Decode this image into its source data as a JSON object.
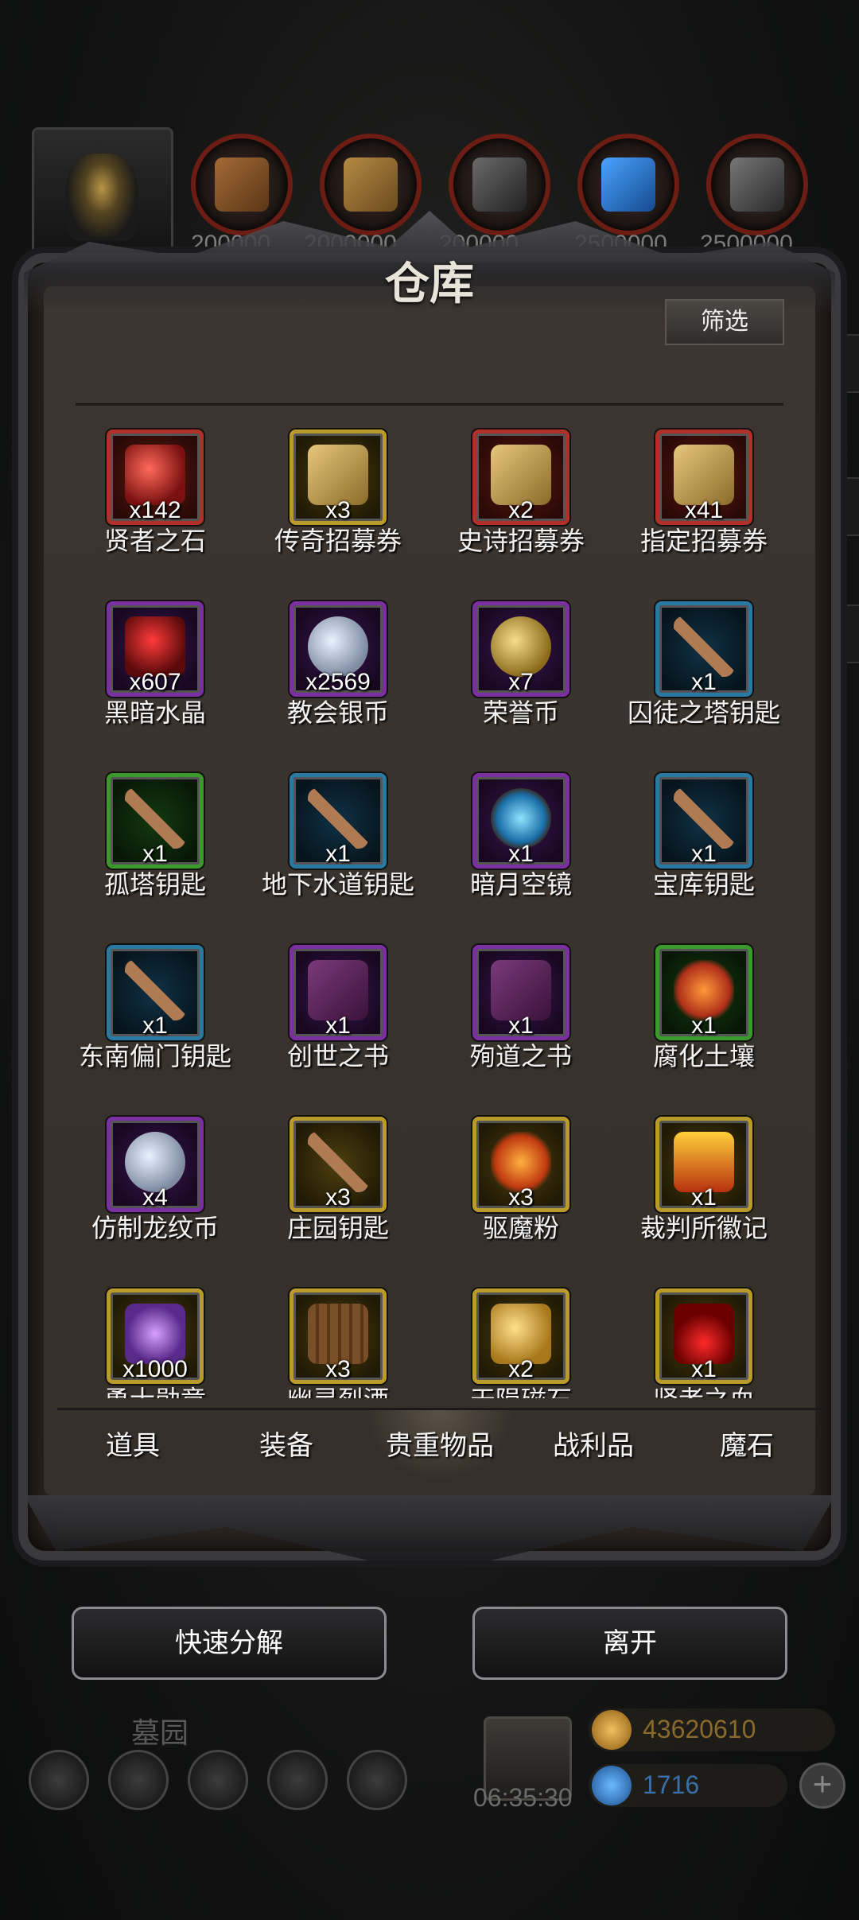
{
  "top_bar": {
    "resources": [
      {
        "icon": "wood-log-icon",
        "color": "#8b5a2b",
        "count": "200000"
      },
      {
        "icon": "plank-icon",
        "color": "#a67c3a",
        "count": "2000000"
      },
      {
        "icon": "iron-ingot-icon",
        "color": "#4a4a4a",
        "count": "200000"
      },
      {
        "icon": "blue-crystal-icon",
        "color": "#2a6fc4",
        "count": "2500000"
      },
      {
        "icon": "stone-block-icon",
        "color": "#555555",
        "count": "2500000"
      }
    ]
  },
  "panel": {
    "title": "仓库",
    "filter_label": "筛选"
  },
  "items": [
    {
      "name": "贤者之石",
      "qty": "x142",
      "rarity": "red",
      "icon": "red-stone-icon"
    },
    {
      "name": "传奇招募券",
      "qty": "x3",
      "rarity": "gold",
      "icon": "scroll-icon"
    },
    {
      "name": "史诗招募券",
      "qty": "x2",
      "rarity": "red",
      "icon": "scroll-icon"
    },
    {
      "name": "指定招募券",
      "qty": "x41",
      "rarity": "red",
      "icon": "scroll-icon"
    },
    {
      "name": "黑暗水晶",
      "qty": "x607",
      "rarity": "purple",
      "icon": "dark-crystal-icon"
    },
    {
      "name": "教会银币",
      "qty": "x2569",
      "rarity": "purple",
      "icon": "silver-coin-icon"
    },
    {
      "name": "荣誉币",
      "qty": "x7",
      "rarity": "purple",
      "icon": "gold-coin-icon"
    },
    {
      "name": "囚徒之塔钥匙",
      "qty": "x1",
      "rarity": "blue",
      "icon": "key-icon"
    },
    {
      "name": "孤塔钥匙",
      "qty": "x1",
      "rarity": "green",
      "icon": "key-icon"
    },
    {
      "name": "地下水道钥匙",
      "qty": "x1",
      "rarity": "blue",
      "icon": "key-icon"
    },
    {
      "name": "暗月空镜",
      "qty": "x1",
      "rarity": "purple",
      "icon": "mirror-icon"
    },
    {
      "name": "宝库钥匙",
      "qty": "x1",
      "rarity": "blue",
      "icon": "key-icon"
    },
    {
      "name": "东南偏门钥匙",
      "qty": "x1",
      "rarity": "blue",
      "icon": "key-icon"
    },
    {
      "name": "创世之书",
      "qty": "x1",
      "rarity": "purple",
      "icon": "book-icon"
    },
    {
      "name": "殉道之书",
      "qty": "x1",
      "rarity": "purple",
      "icon": "book-icon"
    },
    {
      "name": "腐化土壤",
      "qty": "x1",
      "rarity": "green",
      "icon": "soil-icon"
    },
    {
      "name": "仿制龙纹币",
      "qty": "x4",
      "rarity": "purple",
      "icon": "silver-coin-icon"
    },
    {
      "name": "庄园钥匙",
      "qty": "x3",
      "rarity": "gold",
      "icon": "key-icon"
    },
    {
      "name": "驱魔粉",
      "qty": "x3",
      "rarity": "gold",
      "icon": "powder-icon"
    },
    {
      "name": "裁判所徽记",
      "qty": "x1",
      "rarity": "gold",
      "icon": "emblem-icon"
    },
    {
      "name": "勇士勋章",
      "qty": "x1000",
      "rarity": "gold",
      "icon": "medal-icon"
    },
    {
      "name": "幽灵烈酒",
      "qty": "x3",
      "rarity": "gold",
      "icon": "barrel-icon"
    },
    {
      "name": "天陨磁石",
      "qty": "x2",
      "rarity": "gold",
      "icon": "gold-ore-icon"
    },
    {
      "name": "贤者之血",
      "qty": "x1",
      "rarity": "gold",
      "icon": "blood-drop-icon"
    }
  ],
  "tabs": [
    {
      "label": "道具"
    },
    {
      "label": "装备"
    },
    {
      "label": "贵重物品",
      "active": true
    },
    {
      "label": "战利品"
    },
    {
      "label": "魔石"
    }
  ],
  "actions": {
    "quick_decompose": "快速分解",
    "leave": "离开"
  },
  "hud": {
    "location": "墓园",
    "timer": "06:35:30",
    "gold": "43620610",
    "gems": "1716"
  }
}
